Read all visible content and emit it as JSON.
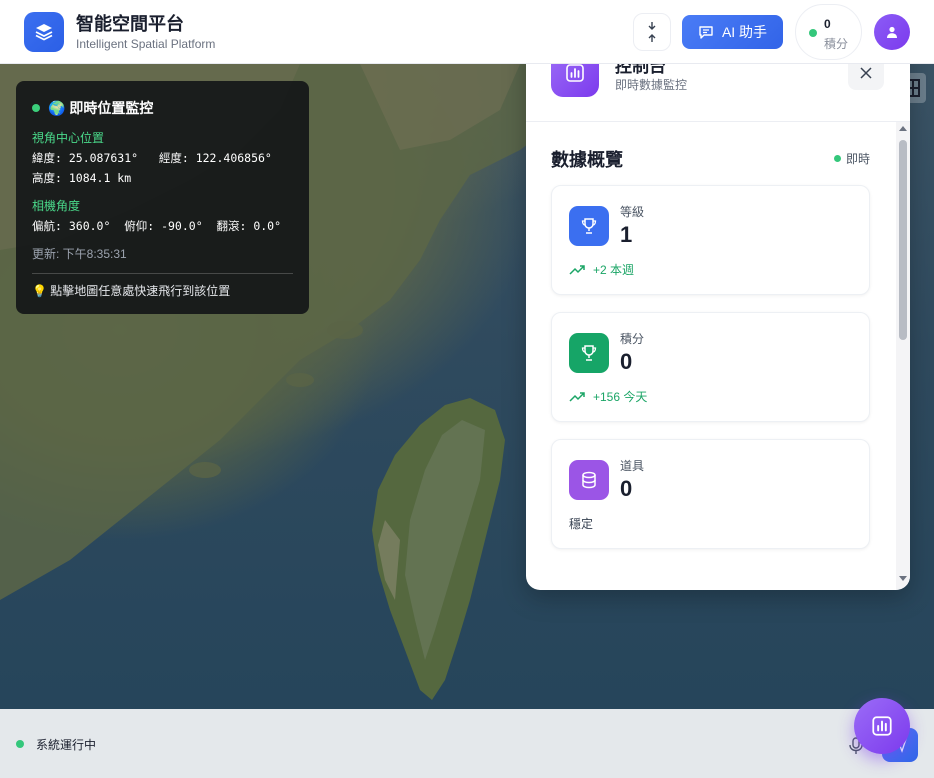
{
  "header": {
    "title": "智能空間平台",
    "subtitle": "Intelligent Spatial Platform",
    "ai_button": "AI 助手",
    "score_value": "0",
    "score_label": "積分"
  },
  "monitor": {
    "title": "🌍 即時位置監控",
    "center_label": "視角中心位置",
    "lat_lon": "緯度: 25.087631°   經度: 122.406856°",
    "altitude": "高度: 1084.1 km",
    "camera_label": "相機角度",
    "camera_values": "偏航: 360.0°  俯仰: -90.0°  翻滾: 0.0°",
    "updated": "更新: 下午8:35:31",
    "hint": "💡 點擊地圖任意處快速飛行到該位置"
  },
  "dashboard": {
    "title": "控制台",
    "subtitle": "即時數據監控",
    "overview_title": "數據概覽",
    "live_label": "即時",
    "cards": [
      {
        "label": "等級",
        "value": "1",
        "trend": "+2 本週",
        "color": "#3b6ff0",
        "icon": "trophy-icon"
      },
      {
        "label": "積分",
        "value": "0",
        "trend": "+156 今天",
        "color": "#16a567",
        "icon": "trophy-icon"
      },
      {
        "label": "道具",
        "value": "0",
        "status": "穩定",
        "color": "#9b55e6",
        "icon": "database-icon"
      }
    ]
  },
  "bottom": {
    "status": "系統運行中"
  }
}
